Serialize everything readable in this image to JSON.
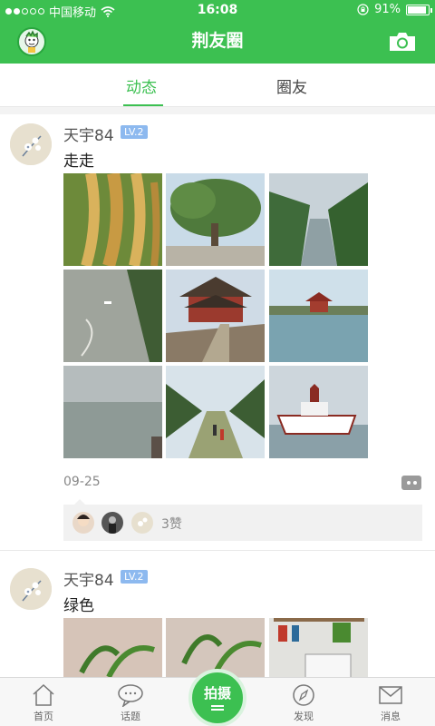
{
  "status": {
    "carrier": "中国移动",
    "time": "16:08",
    "battery": "91%"
  },
  "header": {
    "title": "荆友圈"
  },
  "tabs": [
    {
      "label": "动态",
      "active": true
    },
    {
      "label": "圈友",
      "active": false
    }
  ],
  "posts": [
    {
      "user": "天宇84",
      "level": "LV.2",
      "text": "走走",
      "photos": [
        "rice-ears",
        "big-tree",
        "river-gorge",
        "boat-river",
        "palace-tower",
        "lake-pavilion",
        "foggy-lake",
        "tree-lined-path",
        "river-ship"
      ],
      "date": "09-25",
      "likes": "3赞"
    },
    {
      "user": "天宇84",
      "level": "LV.2",
      "text": "绿色",
      "photos": [
        "potted-plant",
        "potted-plant-2",
        "office-shelf"
      ]
    }
  ],
  "nav": [
    {
      "label": "首页",
      "icon": "home-icon"
    },
    {
      "label": "话题",
      "icon": "chat-icon"
    },
    {
      "label": "拍摄",
      "icon": "shoot-icon"
    },
    {
      "label": "发现",
      "icon": "compass-icon"
    },
    {
      "label": "消息",
      "icon": "mail-icon"
    }
  ],
  "colors": {
    "brand": "#3cc051",
    "level_badge": "#8db9ef"
  }
}
